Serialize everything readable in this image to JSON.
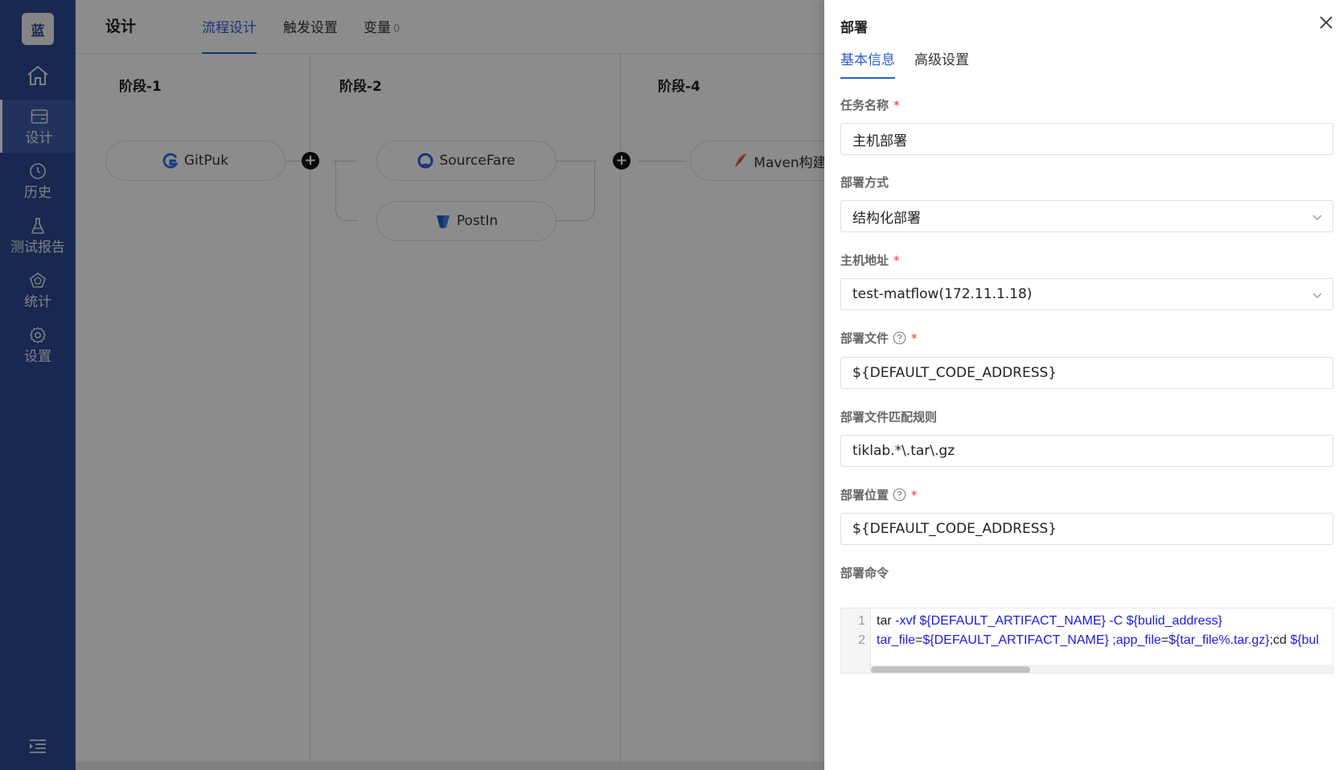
{
  "sidebar": {
    "logo_text": "蓝",
    "home_icon": "home-icon",
    "items": [
      {
        "label": "设计",
        "icon": "design-icon",
        "active": true
      },
      {
        "label": "历史",
        "icon": "clock-icon",
        "active": false
      },
      {
        "label": "测试报告",
        "icon": "flask-icon",
        "active": false
      },
      {
        "label": "统计",
        "icon": "stats-icon",
        "active": false
      },
      {
        "label": "设置",
        "icon": "gear-icon",
        "active": false
      }
    ],
    "collapse_icon": "menu-collapse-icon",
    "bg_color": "#2c4a93"
  },
  "header": {
    "title": "设计",
    "tabs": [
      {
        "label": "流程设计",
        "active": true
      },
      {
        "label": "触发设置",
        "active": false
      },
      {
        "label": "变量",
        "badge": "0",
        "active": false
      }
    ]
  },
  "pipeline": {
    "stages": [
      {
        "title": "阶段-1",
        "tasks": [
          "GitPuk"
        ]
      },
      {
        "title": "阶段-2",
        "tasks": [
          "SourceFare",
          "PostIn"
        ]
      },
      {
        "title": "阶段-4",
        "tasks": [
          "Maven构建"
        ]
      }
    ],
    "add_symbol": "+"
  },
  "drawer": {
    "title": "部署",
    "tabs": [
      {
        "label": "基本信息",
        "active": true
      },
      {
        "label": "高级设置",
        "active": false
      }
    ],
    "fields": {
      "task_name": {
        "label": "任务名称",
        "value": "主机部署",
        "required": true
      },
      "deploy_method": {
        "label": "部署方式",
        "value": "结构化部署"
      },
      "host_address": {
        "label": "主机地址",
        "value": "test-matflow(172.11.1.18)",
        "required": true
      },
      "deploy_file": {
        "label": "部署文件",
        "value": "${DEFAULT_CODE_ADDRESS}",
        "required": true
      },
      "deploy_file_pattern": {
        "label": "部署文件匹配规则",
        "value": "tiklab.*\\.tar\\.gz"
      },
      "deploy_location": {
        "label": "部署位置",
        "value": "${DEFAULT_CODE_ADDRESS}",
        "required": true
      },
      "deploy_command": {
        "label": "部署命令",
        "lines": [
          {
            "no": "1",
            "parts": [
              {
                "t": "tar ",
                "plain": true
              },
              {
                "t": "-xvf  ${DEFAULT_ARTIFACT_NAME} -C ${bulid_address}",
                "plain": false
              }
            ]
          },
          {
            "no": "2",
            "parts": [
              {
                "t": "tar_file",
                "plain": false
              },
              {
                "t": "=",
                "plain": true
              },
              {
                "t": "${DEFAULT_ARTIFACT_NAME} ;app_file",
                "plain": false
              },
              {
                "t": "=",
                "plain": true
              },
              {
                "t": "${tar_file%.tar.gz}",
                "plain": false
              },
              {
                "t": ";cd ",
                "plain": true
              },
              {
                "t": "${bul",
                "plain": false
              }
            ]
          }
        ]
      }
    },
    "required_mark": "*",
    "help_icon": "question-circle-icon",
    "close_icon": "close-icon",
    "accent_color": "#2c5dcf"
  }
}
